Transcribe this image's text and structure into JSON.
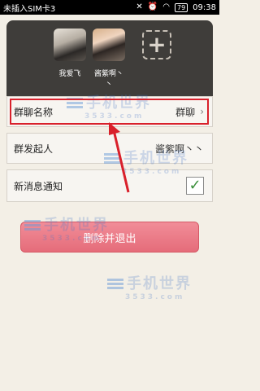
{
  "status_bar": {
    "carrier": "未插入SIM卡3",
    "battery": "79",
    "time": "09:38"
  },
  "members": [
    {
      "name": "我爱飞"
    },
    {
      "name": "酱紫啊丶丶"
    }
  ],
  "rows": {
    "group_name": {
      "label": "群聊名称",
      "value": "群聊"
    },
    "initiator": {
      "label": "群发起人",
      "value": "酱紫啊丶丶"
    },
    "notify": {
      "label": "新消息通知",
      "checked": true
    }
  },
  "exit_button": {
    "label": "删除并退出"
  },
  "watermark": {
    "text": "手机世界",
    "sub": "3533.com"
  }
}
